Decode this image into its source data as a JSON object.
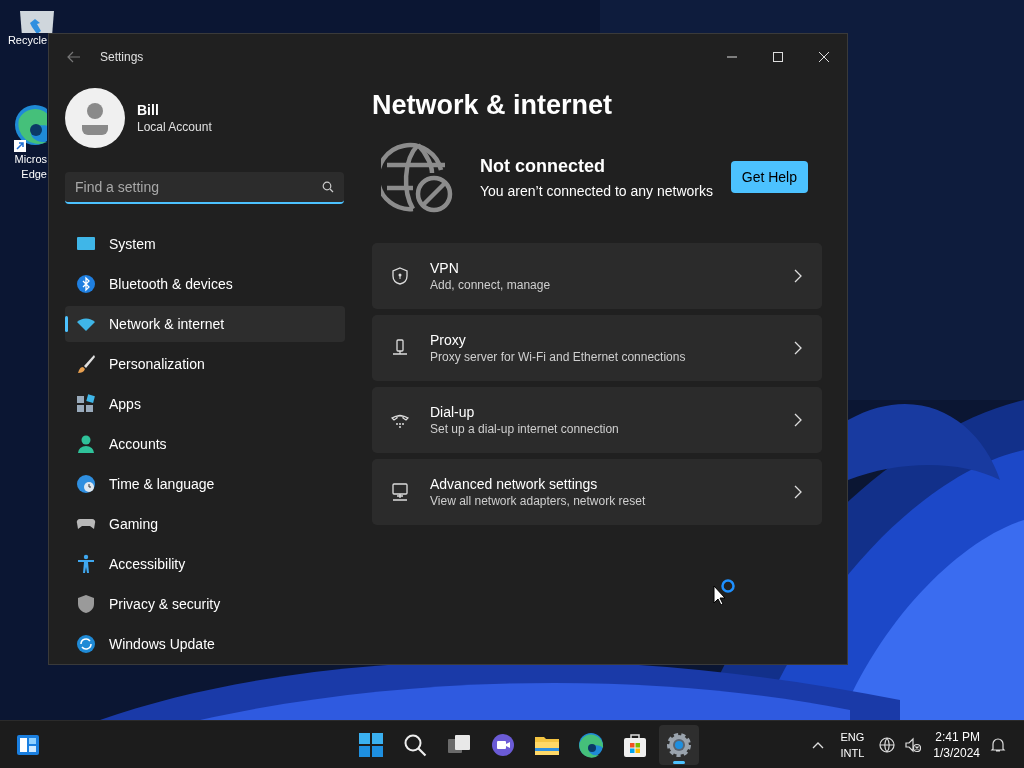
{
  "desktop_icons": [
    {
      "lines": [
        "Recycle"
      ]
    },
    {
      "lines": [
        "Micros",
        "Edge"
      ]
    }
  ],
  "window": {
    "title": "Settings"
  },
  "account": {
    "name": "Bill",
    "type": "Local Account"
  },
  "search": {
    "placeholder": "Find a setting"
  },
  "sidebar": {
    "items": [
      {
        "label": "System",
        "selected": false
      },
      {
        "label": "Bluetooth & devices",
        "selected": false
      },
      {
        "label": "Network & internet",
        "selected": true
      },
      {
        "label": "Personalization",
        "selected": false
      },
      {
        "label": "Apps",
        "selected": false
      },
      {
        "label": "Accounts",
        "selected": false
      },
      {
        "label": "Time & language",
        "selected": false
      },
      {
        "label": "Gaming",
        "selected": false
      },
      {
        "label": "Accessibility",
        "selected": false
      },
      {
        "label": "Privacy & security",
        "selected": false
      },
      {
        "label": "Windows Update",
        "selected": false
      }
    ]
  },
  "page_title": "Network & internet",
  "status": {
    "title": "Not connected",
    "message": "You aren’t connected to any networks",
    "button": "Get Help"
  },
  "cards": [
    {
      "title": "VPN",
      "subtitle": "Add, connect, manage"
    },
    {
      "title": "Proxy",
      "subtitle": "Proxy server for Wi-Fi and Ethernet connections"
    },
    {
      "title": "Dial-up",
      "subtitle": "Set up a dial-up internet connection"
    },
    {
      "title": "Advanced network settings",
      "subtitle": "View all network adapters, network reset"
    }
  ],
  "taskbar": {
    "apps": [
      {
        "selected": false
      },
      {
        "selected": false
      },
      {
        "selected": false
      },
      {
        "selected": false
      },
      {
        "selected": false
      },
      {
        "selected": false
      },
      {
        "selected": false
      },
      {
        "selected": true
      }
    ],
    "language": [
      "ENG",
      "INTL"
    ],
    "time": "2:41 PM",
    "date": "1/3/2024"
  }
}
